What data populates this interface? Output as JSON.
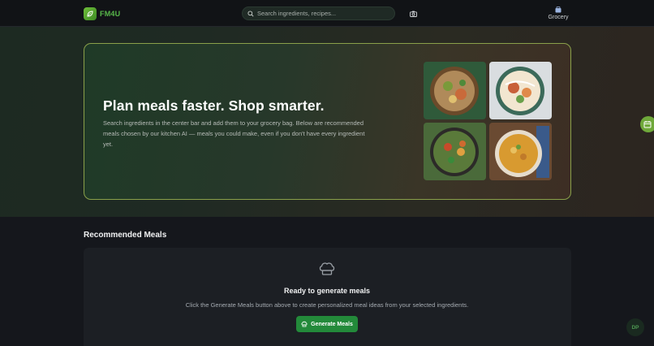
{
  "app": {
    "name": "FM4U",
    "brand_color": "#58b84a"
  },
  "header": {
    "search": {
      "placeholder": "Search ingredients, recipes...",
      "value": ""
    },
    "camera_icon": "camera-icon",
    "grocery_label": "Grocery"
  },
  "hero": {
    "title": "Plan meals faster. Shop smarter.",
    "description": "Search ingredients in the center bar and add them to your grocery bag. Below are recommended meals chosen by our kitchen AI — meals you could make, even if you don't have every ingredient yet.",
    "images": [
      "grain-bowl-photo",
      "poke-bowl-photo",
      "stir-fry-photo",
      "curry-bowl-photo"
    ]
  },
  "recommended": {
    "title": "Recommended Meals",
    "empty_title": "Ready to generate meals",
    "empty_desc": "Click the Generate Meals button above to create personalized meal ideas from your selected ingredients.",
    "button_label": "Generate Meals",
    "button_color": "#238a3a"
  },
  "user": {
    "initials": "DP"
  }
}
